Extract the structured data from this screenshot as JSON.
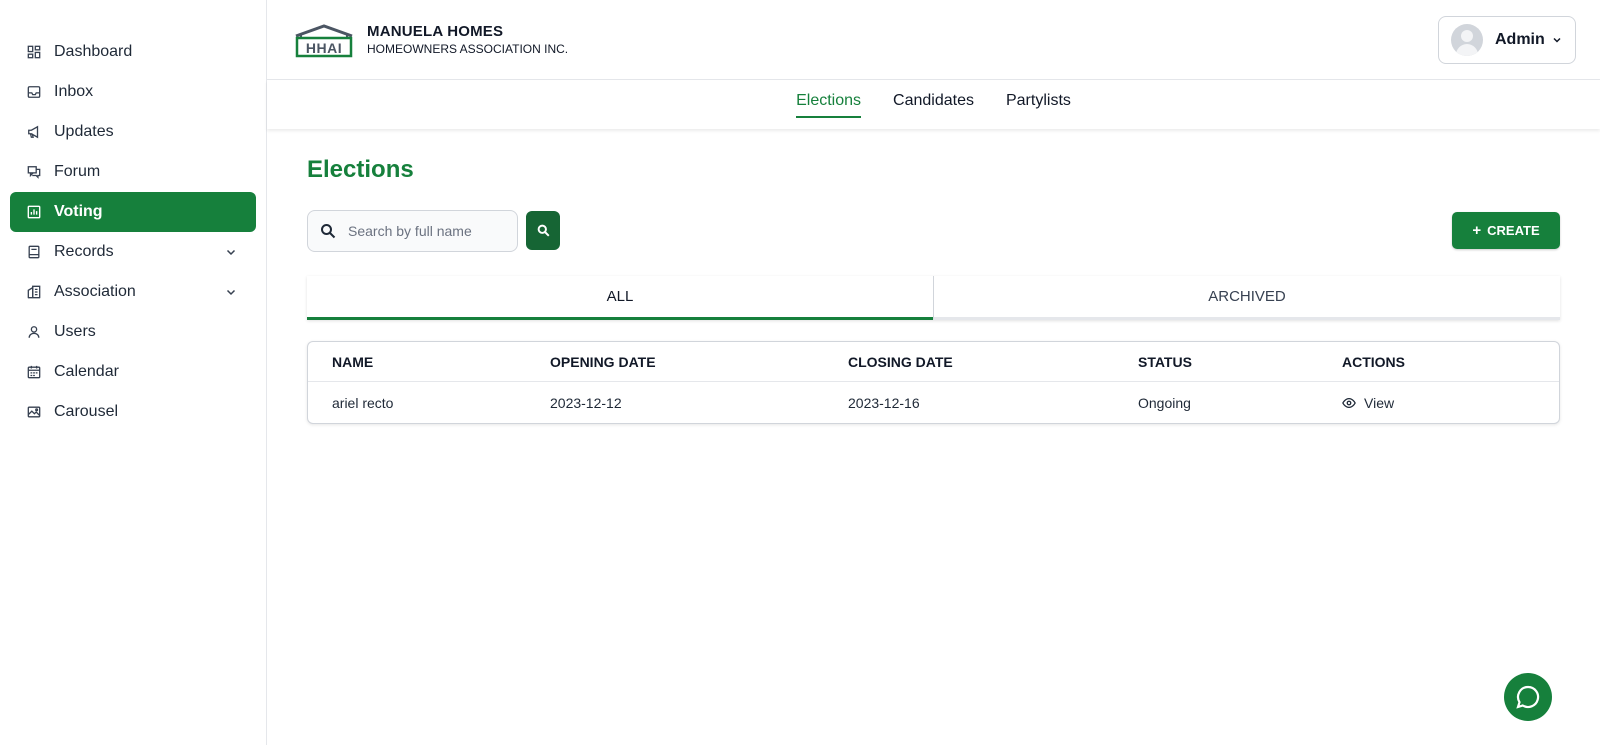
{
  "sidebar": {
    "items": [
      {
        "label": "Dashboard"
      },
      {
        "label": "Inbox"
      },
      {
        "label": "Updates"
      },
      {
        "label": "Forum"
      },
      {
        "label": "Voting"
      },
      {
        "label": "Records"
      },
      {
        "label": "Association"
      },
      {
        "label": "Users"
      },
      {
        "label": "Calendar"
      },
      {
        "label": "Carousel"
      }
    ],
    "active": "Voting"
  },
  "header": {
    "logo_text": "HHAI",
    "brand_title": "MANUELA HOMES",
    "brand_subtitle": "HOMEOWNERS ASSOCIATION INC.",
    "user_name": "Admin"
  },
  "subnav": {
    "tabs": [
      {
        "label": "Elections"
      },
      {
        "label": "Candidates"
      },
      {
        "label": "Partylists"
      }
    ],
    "active": "Elections"
  },
  "main": {
    "title": "Elections",
    "search": {
      "placeholder": "Search by full name",
      "value": ""
    },
    "create_label": "CREATE",
    "create_icon": "+",
    "tabs": [
      {
        "label": "ALL"
      },
      {
        "label": "ARCHIVED"
      }
    ],
    "active_tab": "ALL",
    "table": {
      "columns": [
        "NAME",
        "OPENING DATE",
        "CLOSING DATE",
        "STATUS",
        "ACTIONS"
      ],
      "rows": [
        {
          "name": "ariel recto",
          "opening_date": "2023-12-12",
          "closing_date": "2023-12-16",
          "status": "Ongoing",
          "action": "View"
        }
      ]
    }
  },
  "colors": {
    "accent": "#16803c",
    "accent_dark": "#166534"
  }
}
